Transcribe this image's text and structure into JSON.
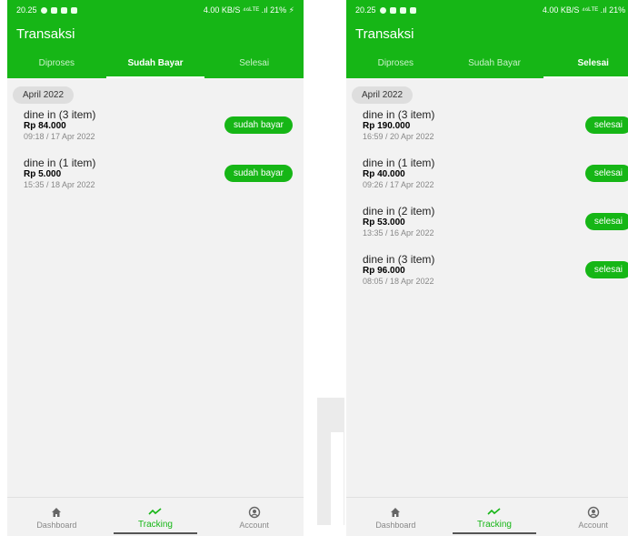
{
  "colors": {
    "accent": "#16b616"
  },
  "screens": [
    {
      "status": {
        "time": "20.25",
        "right": "4.00 KB/S ⁴⁶ᴸᵀᴱ .ıl 21% ⚡"
      },
      "title": "Transaksi",
      "tabs": [
        {
          "label": "Diproses",
          "active": false
        },
        {
          "label": "Sudah Bayar",
          "active": true
        },
        {
          "label": "Selesai",
          "active": false
        }
      ],
      "month": "April 2022",
      "transactions": [
        {
          "title": "dine in (3 item)",
          "amount": "Rp 84.000",
          "date": "09:18 / 17 Apr 2022",
          "button": "sudah bayar"
        },
        {
          "title": "dine in (1 item)",
          "amount": "Rp 5.000",
          "date": "15:35 / 18 Apr 2022",
          "button": "sudah bayar"
        }
      ],
      "nav": [
        {
          "label": "Dashboard",
          "icon": "home-icon",
          "active": false
        },
        {
          "label": "Tracking",
          "icon": "trend-icon",
          "active": true
        },
        {
          "label": "Account",
          "icon": "account-icon",
          "active": false
        }
      ]
    },
    {
      "status": {
        "time": "20.25",
        "right": "4.00 KB/S ⁴⁶ᴸᵀᴱ .ıl 21% ⚡"
      },
      "title": "Transaksi",
      "tabs": [
        {
          "label": "Diproses",
          "active": false
        },
        {
          "label": "Sudah Bayar",
          "active": false
        },
        {
          "label": "Selesai",
          "active": true
        }
      ],
      "month": "April 2022",
      "transactions": [
        {
          "title": "dine in (3 item)",
          "amount": "Rp 190.000",
          "date": "16:59 / 20 Apr 2022",
          "button": "selesai"
        },
        {
          "title": "dine in (1 item)",
          "amount": "Rp 40.000",
          "date": "09:26 / 17 Apr 2022",
          "button": "selesai"
        },
        {
          "title": "dine in (2 item)",
          "amount": "Rp 53.000",
          "date": "13:35 / 16 Apr 2022",
          "button": "selesai"
        },
        {
          "title": "dine in (3 item)",
          "amount": "Rp 96.000",
          "date": "08:05 / 18 Apr 2022",
          "button": "selesai"
        }
      ],
      "nav": [
        {
          "label": "Dashboard",
          "icon": "home-icon",
          "active": false
        },
        {
          "label": "Tracking",
          "icon": "trend-icon",
          "active": true
        },
        {
          "label": "Account",
          "icon": "account-icon",
          "active": false
        }
      ]
    }
  ]
}
